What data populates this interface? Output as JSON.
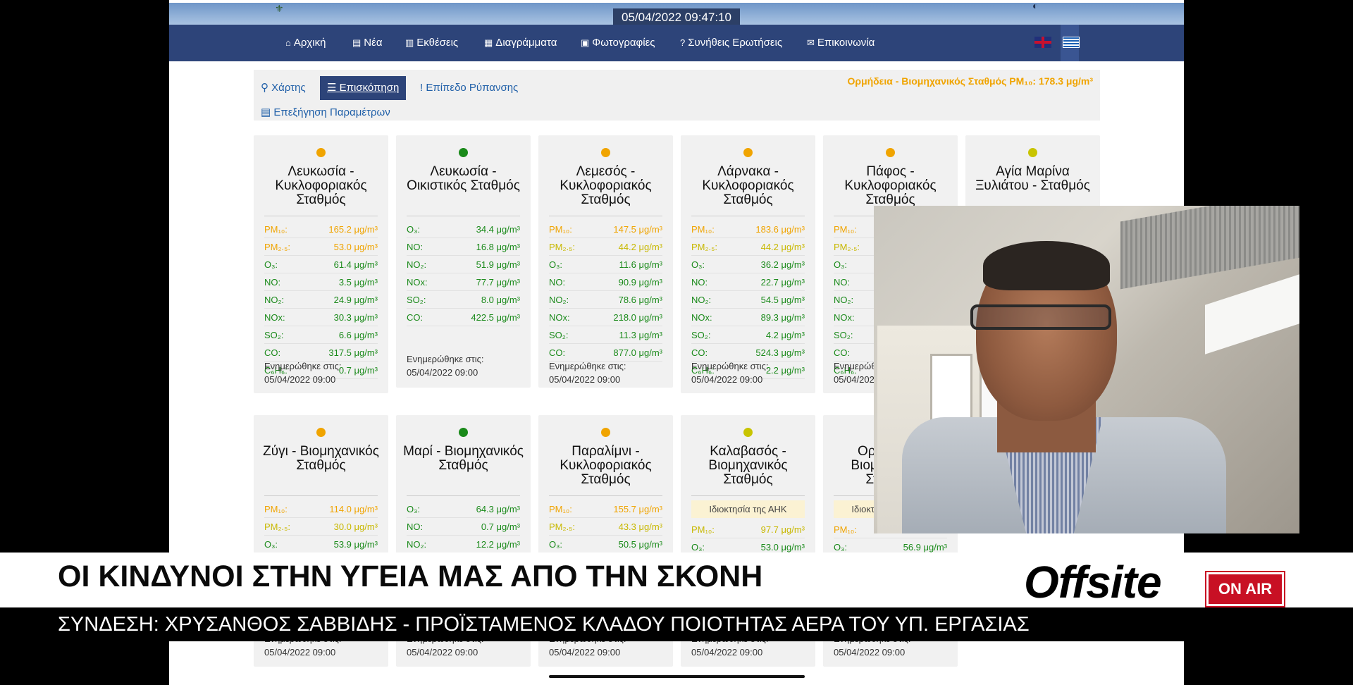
{
  "site": {
    "datetime": "05/04/2022 09:47:10",
    "nav": [
      {
        "label": "Αρχική",
        "icon": "home-icon",
        "glyph": "⌂"
      },
      {
        "label": "Νέα",
        "icon": "file-icon",
        "glyph": "▤"
      },
      {
        "label": "Εκθέσεις",
        "icon": "report-icon",
        "glyph": "▥"
      },
      {
        "label": "Διαγράμματα",
        "icon": "chart-icon",
        "glyph": "▦"
      },
      {
        "label": "Φωτογραφίες",
        "icon": "image-icon",
        "glyph": "▣"
      },
      {
        "label": "Συνήθεις Ερωτήσεις",
        "icon": "question-icon",
        "glyph": "?"
      },
      {
        "label": "Επικοινωνία",
        "icon": "envelope-icon",
        "glyph": "✉"
      }
    ],
    "tabs": {
      "map": "Χάρτης",
      "overview": "Επισκόπηση",
      "pollution": "Επίπεδο Ρύπανσης",
      "params": "Επεξήγηση Παραμέτρων"
    },
    "alert": "Ορμήδεια - Βιομηχανικός Σταθμός PM₁₀: 178.3 μg/m³",
    "updated_label": "Ενημερώθηκε στις:",
    "updated_time": "05/04/2022 09:00",
    "stations_row1": [
      {
        "name": "Λευκωσία - Κυκλοφοριακός Σταθμός",
        "status": "#f0a400",
        "rows": [
          {
            "k": "PM₁₀:",
            "v": "165.2 μg/m³",
            "c": "c-orange"
          },
          {
            "k": "PM₂.₅:",
            "v": "53.0 μg/m³",
            "c": "c-orange"
          },
          {
            "k": "O₃:",
            "v": "61.4 μg/m³",
            "c": "c-green"
          },
          {
            "k": "NO:",
            "v": "3.5 μg/m³",
            "c": "c-green"
          },
          {
            "k": "NO₂:",
            "v": "24.9 μg/m³",
            "c": "c-green"
          },
          {
            "k": "NOx:",
            "v": "30.3 μg/m³",
            "c": "c-green"
          },
          {
            "k": "SO₂:",
            "v": "6.6 μg/m³",
            "c": "c-green"
          },
          {
            "k": "CO:",
            "v": "317.5 μg/m³",
            "c": "c-green"
          },
          {
            "k": "C₆H₆:",
            "v": "0.7 μg/m³",
            "c": "c-green"
          }
        ]
      },
      {
        "name": "Λευκωσία - Οικιστικός Σταθμός",
        "status": "#1a8a1a",
        "rows": [
          {
            "k": "O₃:",
            "v": "34.4 μg/m³",
            "c": "c-green"
          },
          {
            "k": "NO:",
            "v": "16.8 μg/m³",
            "c": "c-green"
          },
          {
            "k": "NO₂:",
            "v": "51.9 μg/m³",
            "c": "c-green"
          },
          {
            "k": "NOx:",
            "v": "77.7 μg/m³",
            "c": "c-green"
          },
          {
            "k": "SO₂:",
            "v": "8.0 μg/m³",
            "c": "c-green"
          },
          {
            "k": "CO:",
            "v": "422.5 μg/m³",
            "c": "c-green"
          }
        ]
      },
      {
        "name": "Λεμεσός - Κυκλοφοριακός Σταθμός",
        "status": "#f0a400",
        "rows": [
          {
            "k": "PM₁₀:",
            "v": "147.5 μg/m³",
            "c": "c-orange"
          },
          {
            "k": "PM₂.₅:",
            "v": "44.2 μg/m³",
            "c": "c-yellow"
          },
          {
            "k": "O₃:",
            "v": "11.6 μg/m³",
            "c": "c-green"
          },
          {
            "k": "NO:",
            "v": "90.9 μg/m³",
            "c": "c-green"
          },
          {
            "k": "NO₂:",
            "v": "78.6 μg/m³",
            "c": "c-green"
          },
          {
            "k": "NOx:",
            "v": "218.0 μg/m³",
            "c": "c-green"
          },
          {
            "k": "SO₂:",
            "v": "11.3 μg/m³",
            "c": "c-green"
          },
          {
            "k": "CO:",
            "v": "877.0 μg/m³",
            "c": "c-green"
          }
        ]
      },
      {
        "name": "Λάρνακα - Κυκλοφοριακός Σταθμός",
        "status": "#f0a400",
        "rows": [
          {
            "k": "PM₁₀:",
            "v": "183.6 μg/m³",
            "c": "c-orange"
          },
          {
            "k": "PM₂.₅:",
            "v": "44.2 μg/m³",
            "c": "c-yellow"
          },
          {
            "k": "O₃:",
            "v": "36.2 μg/m³",
            "c": "c-green"
          },
          {
            "k": "NO:",
            "v": "22.7 μg/m³",
            "c": "c-green"
          },
          {
            "k": "NO₂:",
            "v": "54.5 μg/m³",
            "c": "c-green"
          },
          {
            "k": "NOx:",
            "v": "89.3 μg/m³",
            "c": "c-green"
          },
          {
            "k": "SO₂:",
            "v": "4.2 μg/m³",
            "c": "c-green"
          },
          {
            "k": "CO:",
            "v": "524.3 μg/m³",
            "c": "c-green"
          },
          {
            "k": "C₆H₆:",
            "v": "2.2 μg/m³",
            "c": "c-green"
          }
        ]
      },
      {
        "name": "Πάφος - Κυκλοφοριακός Σταθμός",
        "status": "#f0a400",
        "rows": [
          {
            "k": "PM₁₀:",
            "v": "",
            "c": "c-orange"
          },
          {
            "k": "PM₂.₅:",
            "v": "",
            "c": "c-yellow"
          },
          {
            "k": "O₃:",
            "v": "",
            "c": "c-green"
          },
          {
            "k": "NO:",
            "v": "",
            "c": "c-green"
          },
          {
            "k": "NO₂:",
            "v": "",
            "c": "c-green"
          },
          {
            "k": "NOx:",
            "v": "",
            "c": "c-green"
          },
          {
            "k": "SO₂:",
            "v": "",
            "c": "c-green"
          },
          {
            "k": "CO:",
            "v": "",
            "c": "c-green"
          },
          {
            "k": "C₆H₆:",
            "v": "",
            "c": "c-green"
          }
        ]
      },
      {
        "name": "Αγία Μαρίνα Ξυλιάτου - Σταθμός",
        "status": "#c8c400",
        "rows": []
      }
    ],
    "stations_row2": [
      {
        "name": "Ζύγι - Βιομηχανικός Σταθμός",
        "status": "#f0a400",
        "badge": "",
        "rows": [
          {
            "k": "PM₁₀:",
            "v": "114.0 μg/m³",
            "c": "c-orange"
          },
          {
            "k": "PM₂.₅:",
            "v": "30.0 μg/m³",
            "c": "c-yellow"
          },
          {
            "k": "O₃:",
            "v": "53.9 μg/m³",
            "c": "c-green"
          }
        ]
      },
      {
        "name": "Μαρί - Βιομηχανικός Σταθμός",
        "status": "#1a8a1a",
        "badge": "",
        "rows": [
          {
            "k": "O₃:",
            "v": "64.3 μg/m³",
            "c": "c-green"
          },
          {
            "k": "NO:",
            "v": "0.7 μg/m³",
            "c": "c-green"
          },
          {
            "k": "NO₂:",
            "v": "12.2 μg/m³",
            "c": "c-green"
          }
        ]
      },
      {
        "name": "Παραλίμνι - Κυκλοφοριακός Σταθμός",
        "status": "#f0a400",
        "badge": "",
        "rows": [
          {
            "k": "PM₁₀:",
            "v": "155.7 μg/m³",
            "c": "c-orange"
          },
          {
            "k": "PM₂.₅:",
            "v": "43.3 μg/m³",
            "c": "c-yellow"
          },
          {
            "k": "O₃:",
            "v": "50.5 μg/m³",
            "c": "c-green"
          }
        ]
      },
      {
        "name": "Καλαβασός - Βιομηχανικός Σταθμός",
        "status": "#c8c400",
        "badge": "Ιδιοκτησία της ΑΗΚ",
        "rows": [
          {
            "k": "PM₁₀:",
            "v": "97.7 μg/m³",
            "c": "c-yellow"
          },
          {
            "k": "O₃:",
            "v": "53.0 μg/m³",
            "c": "c-green"
          }
        ]
      },
      {
        "name": "Ορμήδεια - Βιομηχανικός Σταθμός",
        "status": "#f0a400",
        "badge": "Ιδιοκτησία της ΑΗΚ",
        "rows": [
          {
            "k": "PM₁₀:",
            "v": "",
            "c": "c-orange"
          },
          {
            "k": "O₃:",
            "v": "56.9 μg/m³",
            "c": "c-green"
          }
        ]
      }
    ]
  },
  "broadcast": {
    "headline": "ΟΙ ΚΙΝΔΥΝΟΙ ΣΤΗΝ ΥΓΕΙΑ ΜΑΣ ΑΠΟ ΤΗΝ ΣΚΟΝΗ",
    "subline": "ΣΥΝΔΕΣΗ: ΧΡΥΣΑΝΘΟΣ ΣΑΒΒΙΔΗΣ - ΠΡΟΪΣΤΑΜΕΝΟΣ ΚΛΑΔΟΥ ΠΟΙΟΤΗΤΑΣ ΑΕΡΑ ΤΟΥ ΥΠ. ΕΡΓΑΣΙΑΣ",
    "brand": "Offsite",
    "onair": "ON AIR"
  }
}
